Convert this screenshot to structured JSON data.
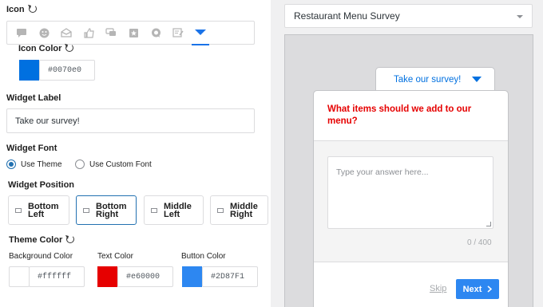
{
  "icon": {
    "label": "Icon",
    "icons": [
      "chat-bubble-icon",
      "smiley-icon",
      "envelope-icon",
      "thumbs-up-icon",
      "chat-bubbles-icon",
      "star-message-icon",
      "speech-bubble-icon",
      "form-edit-icon",
      "caret-down-icon"
    ],
    "selected_index": 8
  },
  "icon_color": {
    "label": "Icon Color",
    "value": "#0070e0",
    "color": "#0070e0"
  },
  "widget_label": {
    "label": "Widget Label",
    "value": "Take our survey!"
  },
  "widget_font": {
    "label": "Widget Font",
    "options": [
      "Use Theme",
      "Use Custom Font"
    ],
    "selected": "Use Theme"
  },
  "widget_position": {
    "label": "Widget Position",
    "options": [
      [
        "Bottom",
        "Left"
      ],
      [
        "Bottom",
        "Right"
      ],
      [
        "Middle",
        "Left"
      ],
      [
        "Middle",
        "Right"
      ]
    ],
    "selected_index": 1
  },
  "theme_color": {
    "label": "Theme Color",
    "background": {
      "label": "Background Color",
      "value": "#ffffff",
      "color": "#ffffff"
    },
    "text": {
      "label": "Text Color",
      "value": "#e60000",
      "color": "#e60000"
    },
    "button": {
      "label": "Button Color",
      "value": "#2D87F1",
      "color": "#2D87F1"
    }
  },
  "preview": {
    "survey_select": "Restaurant Menu Survey",
    "tab_label": "Take our survey!",
    "question": "What items should we add to our menu?",
    "placeholder": "Type your answer here...",
    "char_count": "0 / 400",
    "skip": "Skip",
    "next": "Next"
  }
}
